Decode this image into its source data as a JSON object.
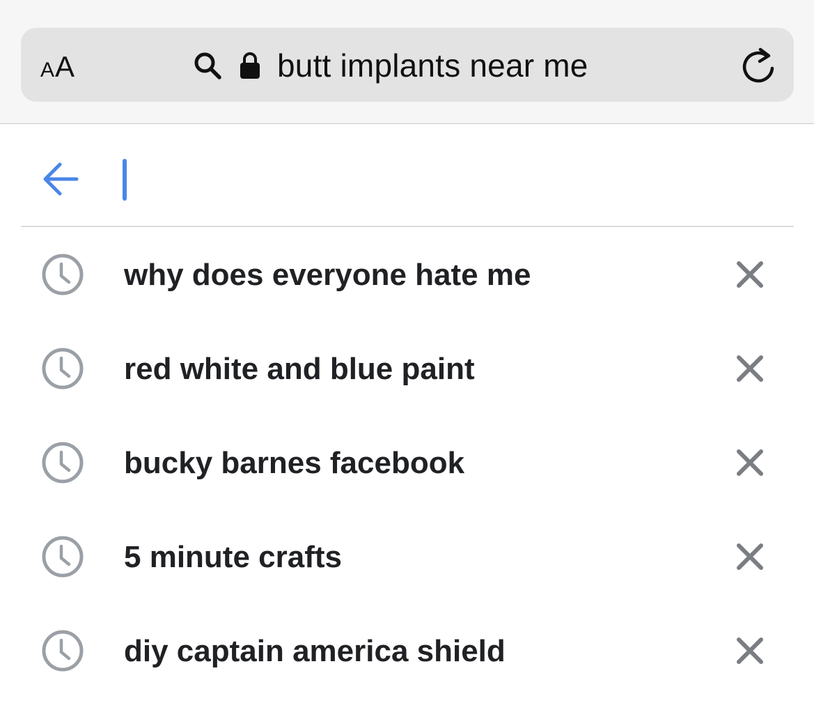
{
  "browser": {
    "text_size_button": {
      "small": "A",
      "large": "A"
    },
    "address_bar": {
      "url_text": "butt implants near me",
      "search_icon": "search-icon",
      "lock_icon": "lock-icon"
    },
    "reload_icon": "reload-icon"
  },
  "search": {
    "back_icon": "arrow-left-icon",
    "query": "",
    "colors": {
      "accent": "#4a86e8",
      "text": "#202124",
      "icon_gray": "#9aa0a6",
      "remove_gray": "#7a7d82"
    }
  },
  "suggestions": [
    {
      "icon": "clock-icon",
      "text": "why does everyone hate me",
      "remove_icon": "close-icon"
    },
    {
      "icon": "clock-icon",
      "text": "red white and blue paint",
      "remove_icon": "close-icon"
    },
    {
      "icon": "clock-icon",
      "text": "bucky barnes facebook",
      "remove_icon": "close-icon"
    },
    {
      "icon": "clock-icon",
      "text": "5 minute crafts",
      "remove_icon": "close-icon"
    },
    {
      "icon": "clock-icon",
      "text": "diy captain america shield",
      "remove_icon": "close-icon"
    }
  ]
}
